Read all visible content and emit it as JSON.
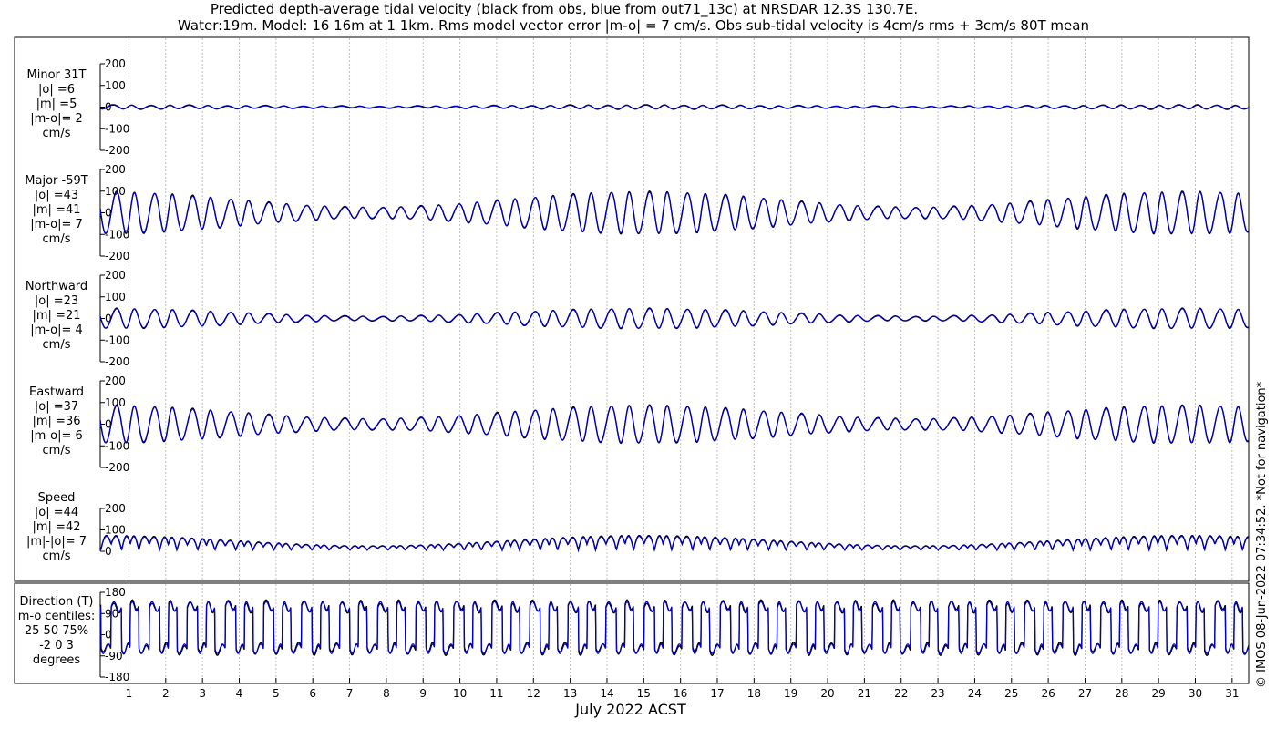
{
  "title_line1": "Predicted depth-average tidal velocity (black from obs, blue from out71_13c) at NRSDAR 12.3S 130.7E.",
  "title_line2": "Water:19m. Model: 16 16m at 1 1km. Rms model vector error |m-o| = 7 cm/s. Obs sub-tidal velocity is 4cm/s rms + 3cm/s 80T mean",
  "xlabel": "July 2022 ACST",
  "side_note": "© IMOS 08-Jun-2022 07:34:52. *Not for navigation*",
  "colors": {
    "obs": "#000000",
    "model": "#0000cc",
    "grid": "#bfbfbf"
  },
  "chart_data": {
    "type": "line",
    "x_unit": "day of July 2022",
    "xlim": [
      0.22,
      31.45
    ],
    "x_ticks": [
      1,
      2,
      3,
      4,
      5,
      6,
      7,
      8,
      9,
      10,
      11,
      12,
      13,
      14,
      15,
      16,
      17,
      18,
      19,
      20,
      21,
      22,
      23,
      24,
      25,
      26,
      27,
      28,
      29,
      30,
      31
    ],
    "series": [
      {
        "name": "obs"
      },
      {
        "name": "model"
      }
    ],
    "panels": [
      {
        "id": "minor",
        "label_lines": [
          "Minor 31T",
          "|o| =6",
          "|m| =5",
          "|m-o|= 2",
          "cm/s"
        ],
        "ylim": [
          -200,
          200
        ],
        "yticks": [
          200,
          100,
          0,
          -100,
          -200
        ],
        "ytick_labels": [
          "200",
          "100",
          "0",
          "-100",
          "-200"
        ],
        "amplitude_range_cm_s": [
          4,
          9
        ],
        "mean_cm_s": 0
      },
      {
        "id": "major",
        "label_lines": [
          "Major -59T",
          "|o| =43",
          "|m| =41",
          "|m-o|= 7",
          "cm/s"
        ],
        "ylim": [
          -200,
          200
        ],
        "yticks": [
          200,
          100,
          0,
          -100,
          -200
        ],
        "ytick_labels": [
          "200",
          "100",
          "0",
          "-100",
          "-200"
        ],
        "amplitude_range_cm_s": [
          25,
          95
        ],
        "mean_cm_s": 0
      },
      {
        "id": "north",
        "label_lines": [
          "Northward",
          "|o| =23",
          "|m| =21",
          "|m-o|= 4",
          "cm/s"
        ],
        "ylim": [
          -200,
          200
        ],
        "yticks": [
          200,
          100,
          0,
          -100,
          -200
        ],
        "ytick_labels": [
          "200",
          "100",
          "0",
          "-100",
          "-200"
        ],
        "amplitude_range_cm_s": [
          10,
          45
        ],
        "mean_cm_s": 0
      },
      {
        "id": "east",
        "label_lines": [
          "Eastward",
          "|o| =37",
          "|m| =36",
          "|m-o|= 6",
          "cm/s"
        ],
        "ylim": [
          -200,
          200
        ],
        "yticks": [
          200,
          100,
          0,
          -100,
          -200
        ],
        "ytick_labels": [
          "200",
          "100",
          "0",
          "-100",
          "-200"
        ],
        "amplitude_range_cm_s": [
          25,
          85
        ],
        "mean_cm_s": 0
      },
      {
        "id": "speed",
        "label_lines": [
          "Speed",
          "|o| =44",
          "|m| =42",
          "|m|-|o|= 7",
          "cm/s"
        ],
        "ylim": [
          0,
          200
        ],
        "yticks": [
          200,
          100,
          0
        ],
        "ytick_labels": [
          "200",
          "100",
          "0"
        ],
        "speed_range_cm_s": [
          5,
          100
        ],
        "mean_cm_s": 0
      },
      {
        "id": "direction",
        "label_lines": [
          "Direction (T)",
          "m-o centiles:",
          "25  50  75%",
          "-2  0  3",
          "degrees"
        ],
        "ylim": [
          -180,
          180
        ],
        "yticks": [
          180,
          90,
          0,
          -90,
          -180
        ],
        "ytick_labels": [
          "180",
          "90",
          "0",
          "-90",
          "-180"
        ],
        "ebb_direction_deg": -60,
        "flood_direction_deg": 120
      }
    ],
    "modulation": {
      "note": "Tidal amplitude varies over the month with spring tides near 14-16 and 28-31 July and neap tides near 8-10 and 22-25 July."
    }
  }
}
